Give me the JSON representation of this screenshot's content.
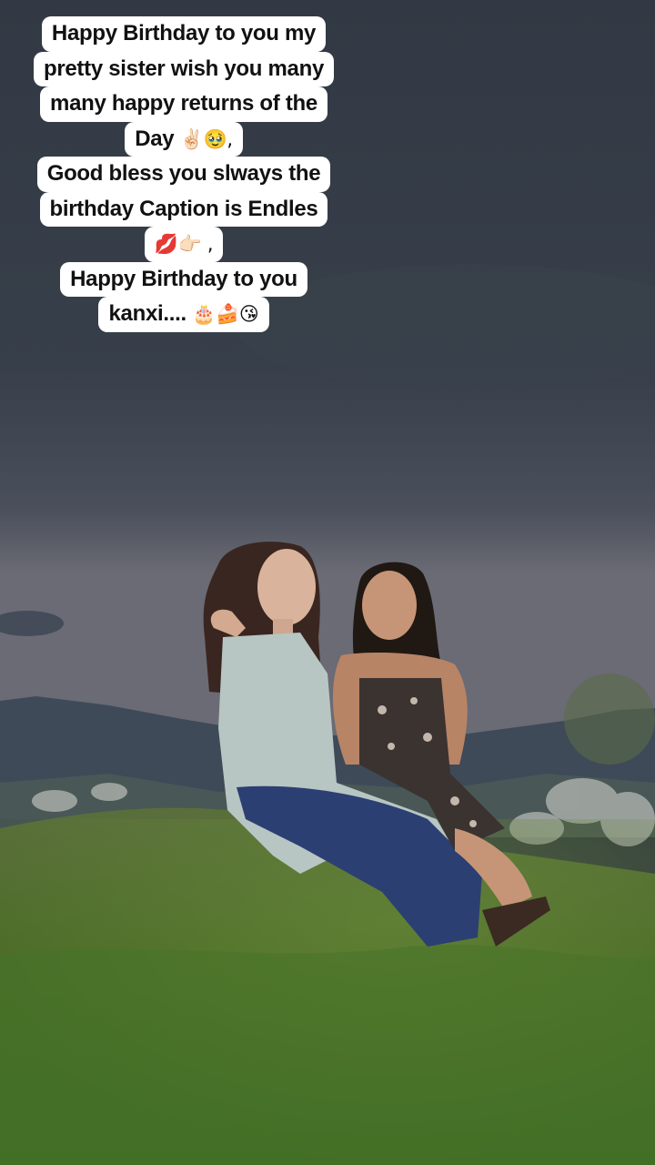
{
  "caption": {
    "lines": [
      {
        "text": "Happy Birthday to you my",
        "emoji": ""
      },
      {
        "text": "pretty sister wish you many",
        "emoji": ""
      },
      {
        "text": "many happy returns of the",
        "emoji": ""
      },
      {
        "text": "Day",
        "emoji": "✌🏻🥹,"
      },
      {
        "text": "Good bless you slways the",
        "emoji": ""
      },
      {
        "text": "birthday Caption is Endles",
        "emoji": ""
      },
      {
        "text": "",
        "emoji": "💋👉🏻 ,"
      },
      {
        "text": "Happy Birthday to you",
        "emoji": ""
      },
      {
        "text": "kanxi....",
        "emoji": "🎂🍰😘"
      }
    ]
  },
  "colors": {
    "sky_top": "#343c47",
    "sky_bottom": "#5b5f6a",
    "mountains": "#3f4b5a",
    "grass": "#4f6b2c",
    "caption_bg": "#ffffff",
    "caption_text": "#111111"
  }
}
